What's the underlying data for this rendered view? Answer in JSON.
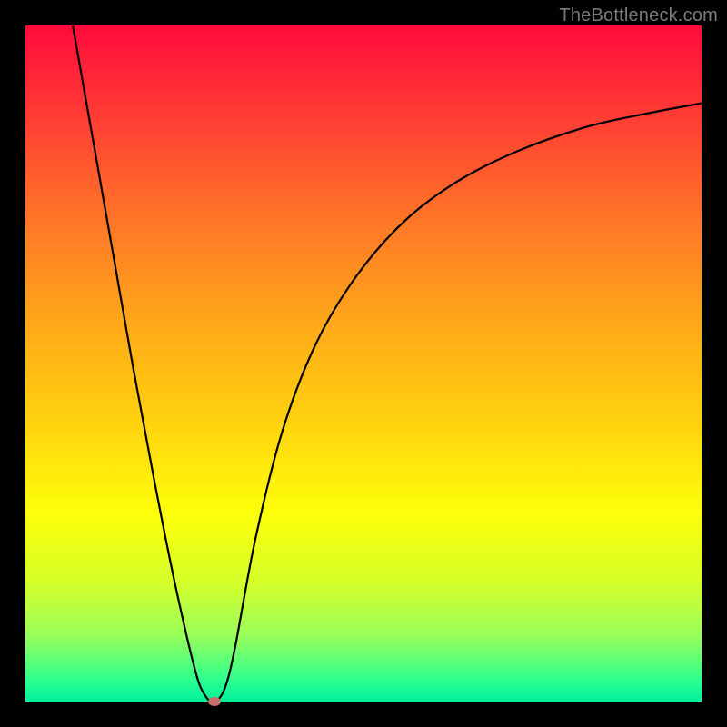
{
  "watermark": {
    "text": "TheBottleneck.com"
  },
  "chart_data": {
    "type": "line",
    "title": "",
    "xlabel": "",
    "ylabel": "",
    "xlim": [
      0,
      100
    ],
    "ylim": [
      0,
      100
    ],
    "grid": false,
    "series": [
      {
        "name": "curve",
        "x": [
          7,
          10,
          13,
          16,
          19,
          22,
          25,
          26.5,
          28,
          29.5,
          31,
          34,
          38,
          43,
          49,
          56,
          64,
          73,
          83,
          92,
          100
        ],
        "y": [
          100,
          83,
          66,
          49,
          33,
          18,
          5,
          1,
          0,
          2,
          8,
          24,
          40,
          53,
          63,
          71,
          77,
          81.5,
          85,
          87,
          88.5
        ]
      }
    ],
    "marker": {
      "x": 28,
      "y": 0
    },
    "colors": {
      "curve": "#000000",
      "marker": "#c76e6a",
      "gradient_top": "#ff0a3a",
      "gradient_bottom": "#00f09a"
    }
  }
}
